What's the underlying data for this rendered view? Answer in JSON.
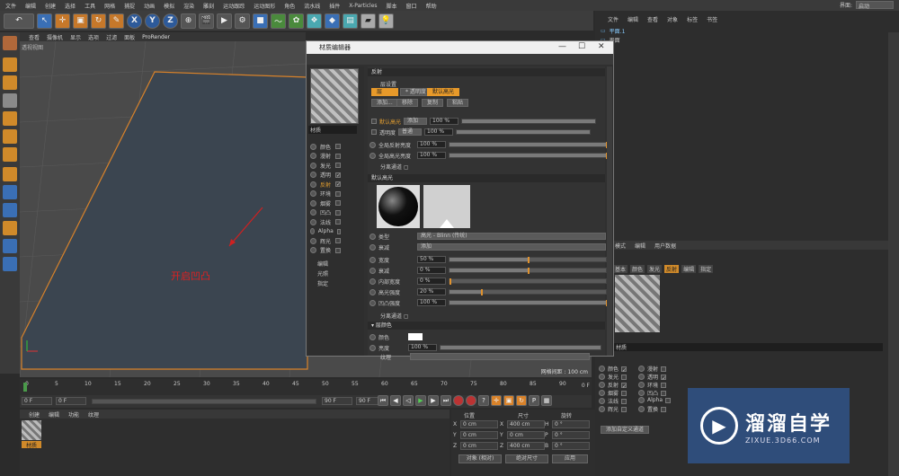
{
  "menu": {
    "items": [
      "文件",
      "编辑",
      "创建",
      "选择",
      "工具",
      "网格",
      "捕捉",
      "动画",
      "模拟",
      "渲染",
      "雕刻",
      "运动跟踪",
      "运动图形",
      "角色",
      "流水线",
      "插件",
      "X-Particles",
      "脚本",
      "窗口",
      "帮助"
    ],
    "interface_label": "界面:",
    "interface_value": "启动"
  },
  "viewport": {
    "menu": [
      "查看",
      "摄像机",
      "显示",
      "选项",
      "过滤",
      "面板",
      "ProRender"
    ],
    "camera_label": "透视视图",
    "grid_info": "网格间距 : 100 cm"
  },
  "annotation": {
    "text": "开启凹凸"
  },
  "timeline": {
    "ticks": [
      "0",
      "5",
      "10",
      "15",
      "20",
      "25",
      "30",
      "35",
      "40",
      "45",
      "50",
      "55",
      "60",
      "65",
      "70",
      "75",
      "80",
      "85",
      "90"
    ],
    "frame_end": "0 F",
    "start": "0 F",
    "min": "0 F",
    "max": "90 F",
    "max2": "90 F"
  },
  "material_manager": {
    "tabs": [
      "创建",
      "编辑",
      "功能",
      "纹理"
    ],
    "material_name": "材质"
  },
  "coords": {
    "headers": [
      "位置",
      "尺寸",
      "旋转"
    ],
    "rows": [
      {
        "axis": "X",
        "pos": "0 cm",
        "size_axis": "X",
        "size": "400 cm",
        "rot_axis": "H",
        "rot": "0 °"
      },
      {
        "axis": "Y",
        "pos": "0 cm",
        "size_axis": "Y",
        "size": "0 cm",
        "rot_axis": "P",
        "rot": "0 °"
      },
      {
        "axis": "Z",
        "pos": "0 cm",
        "size_axis": "Z",
        "size": "400 cm",
        "rot_axis": "B",
        "rot": "0 °"
      }
    ],
    "mode": "对象 (相对)",
    "size_mode": "绝对尺寸",
    "apply": "应用"
  },
  "object_manager": {
    "tabs": [
      "文件",
      "编辑",
      "查看",
      "对象",
      "标签",
      "书签"
    ],
    "objects": [
      "平面.1",
      "平面"
    ]
  },
  "attributes": {
    "tabs": [
      "模式",
      "编辑",
      "用户数据"
    ],
    "subtabs": [
      "基本",
      "颜色",
      "发光",
      "反射",
      "编辑",
      "指定"
    ],
    "active_subtab": "反射",
    "name_label": "材质",
    "channels_left": [
      {
        "label": "颜色",
        "checked": true
      },
      {
        "label": "发光",
        "checked": false
      },
      {
        "label": "反射",
        "checked": true
      },
      {
        "label": "烟雾",
        "checked": false
      },
      {
        "label": "法线",
        "checked": false
      },
      {
        "label": "辉光",
        "checked": false
      }
    ],
    "channels_right": [
      {
        "label": "漫射",
        "checked": false
      },
      {
        "label": "透明",
        "checked": true
      },
      {
        "label": "环境",
        "checked": false
      },
      {
        "label": "凹凸",
        "checked": false
      },
      {
        "label": "Alpha",
        "checked": false
      },
      {
        "label": "置换",
        "checked": false
      }
    ],
    "custom_btn": "添加自定义通道"
  },
  "watermark": {
    "brand": "溜溜自学",
    "url": "ZIXUE.3D66.COM"
  },
  "material_editor": {
    "title": "材质编辑器",
    "material_name": "材质",
    "channels": [
      {
        "label": "颜色",
        "checked": false
      },
      {
        "label": "漫射",
        "checked": false
      },
      {
        "label": "发光",
        "checked": false
      },
      {
        "label": "透明",
        "checked": true
      },
      {
        "label": "反射",
        "checked": true
      },
      {
        "label": "环境",
        "checked": false
      },
      {
        "label": "烟雾",
        "checked": false
      },
      {
        "label": "凹凸",
        "checked": false
      },
      {
        "label": "法线",
        "checked": false
      },
      {
        "label": "Alpha",
        "checked": false
      },
      {
        "label": "辉光",
        "checked": false
      },
      {
        "label": "置换",
        "checked": false
      }
    ],
    "extra_links": [
      "编辑",
      "光照",
      "指定"
    ],
    "reflection_header": "反射",
    "layer_settings": "层设置",
    "layer_tab": "层",
    "transparency_tab": "* 透明度 *",
    "default_spec_tab": "默认高光",
    "btns": [
      "添加...",
      "移除",
      "复制",
      "粘贴"
    ],
    "layer1_name": "默认高光",
    "layer1_mode": "添加",
    "layer1_value": "100 %",
    "layer2_name": "透明度",
    "layer2_mode": "普通",
    "layer2_value": "100 %",
    "global_refl_label": "全局反射亮度",
    "global_refl": "100 %",
    "global_spec_label": "全局高光亮度",
    "global_spec": "100 %",
    "sep_pass_label": "分离通道",
    "default_spec_header": "默认高光",
    "type_label": "类型",
    "type_value": "高光 - Blinn (传统)",
    "atten_label": "衰减",
    "atten_value": "添加",
    "params": [
      {
        "label": "宽度",
        "value": "50 %",
        "frac": 0.5
      },
      {
        "label": "衰减",
        "value": "0 %",
        "frac": 0.5
      },
      {
        "label": "内部宽度",
        "value": "0 %",
        "frac": 0.0
      },
      {
        "label": "高光强度",
        "value": "20 %",
        "frac": 0.2
      },
      {
        "label": "凹凸强度",
        "value": "100 %",
        "frac": 1.0
      }
    ],
    "sep_pass2": "分离通道",
    "layer_color_header": "层颜色",
    "color_label": "颜色",
    "brightness_label": "亮度",
    "brightness_value": "100 %",
    "texture_label": "纹理"
  }
}
